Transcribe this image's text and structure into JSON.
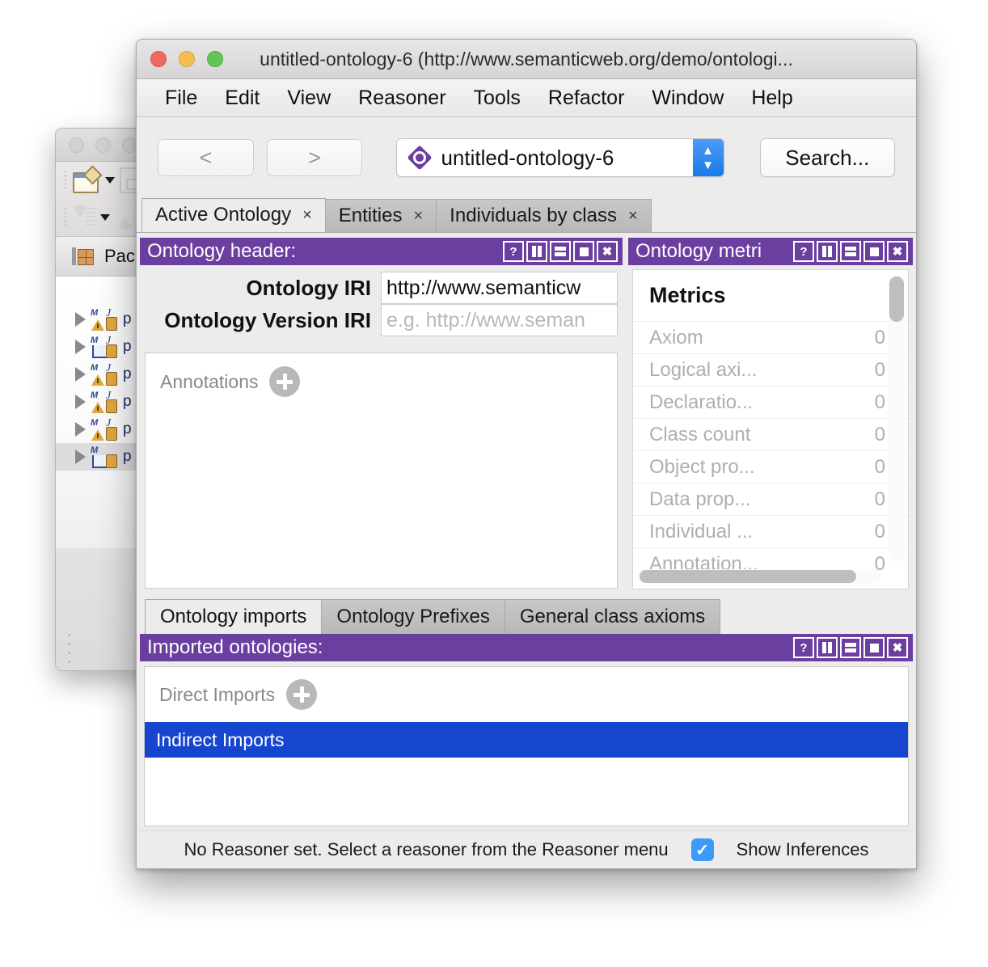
{
  "background_window": {
    "view_tab_label": "Pack",
    "tree_items": [
      {
        "label": "p",
        "type": "jar-warning"
      },
      {
        "label": "p",
        "type": "jar-folder"
      },
      {
        "label": "p",
        "type": "jar-warning"
      },
      {
        "label": "p",
        "type": "jar-warning"
      },
      {
        "label": "p",
        "type": "jar-warning"
      },
      {
        "label": "p",
        "type": "jar-folder",
        "selected": true
      }
    ]
  },
  "window": {
    "title": "untitled-ontology-6 (http://www.semanticweb.org/demo/ontologi...",
    "traffic_lights": [
      "close",
      "minimize",
      "maximize"
    ]
  },
  "menubar": {
    "items": [
      "File",
      "Edit",
      "View",
      "Reasoner",
      "Tools",
      "Refactor",
      "Window",
      "Help"
    ]
  },
  "toolbar": {
    "back_label": "<",
    "forward_label": ">",
    "ontology_combo_value": "untitled-ontology-6",
    "search_label": "Search..."
  },
  "top_tabs": [
    {
      "label": "Active Ontology",
      "close": "×",
      "active": true
    },
    {
      "label": "Entities",
      "close": "×",
      "active": false
    },
    {
      "label": "Individuals by class",
      "close": "×",
      "active": false
    }
  ],
  "ontology_header_panel": {
    "title": "Ontology header:",
    "buttons": [
      "?",
      "split-vertical",
      "split-horizontal",
      "maximize",
      "close"
    ],
    "iri_label": "Ontology IRI",
    "iri_value": "http://www.semanticw",
    "version_label": "Ontology Version IRI",
    "version_placeholder": "e.g. http://www.seman",
    "annotations_label": "Annotations",
    "add_annotation_icon": "plus-icon"
  },
  "ontology_metrics_panel": {
    "title": "Ontology metri",
    "buttons": [
      "?",
      "split-vertical",
      "split-horizontal",
      "maximize",
      "close"
    ],
    "metrics_heading": "Metrics",
    "rows": [
      {
        "name": "Axiom",
        "value": "0"
      },
      {
        "name": "Logical axi...",
        "value": "0"
      },
      {
        "name": "Declaratio...",
        "value": "0"
      },
      {
        "name": "Class count",
        "value": "0"
      },
      {
        "name": "Object pro...",
        "value": "0"
      },
      {
        "name": "Data prop...",
        "value": "0"
      },
      {
        "name": "Individual ...",
        "value": "0"
      },
      {
        "name": "Annotation...",
        "value": "0"
      }
    ]
  },
  "mid_tabs": [
    {
      "label": "Ontology imports",
      "active": true
    },
    {
      "label": "Ontology Prefixes",
      "active": false
    },
    {
      "label": "General class axioms",
      "active": false
    }
  ],
  "imported_ontologies_panel": {
    "title": "Imported ontologies:",
    "buttons": [
      "?",
      "split-vertical",
      "split-horizontal",
      "maximize",
      "close"
    ],
    "direct_imports_label": "Direct Imports",
    "add_import_icon": "plus-icon",
    "indirect_imports_label": "Indirect Imports"
  },
  "statusbar": {
    "message": "No Reasoner set. Select a reasoner from the Reasoner menu",
    "show_inferences_label": "Show Inferences",
    "show_inferences_checked": true,
    "check_glyph": "✓"
  },
  "colors": {
    "panel_header_purple": "#6b3fa0",
    "selection_blue": "#1645d0",
    "checkbox_blue": "#3d9bf7",
    "window_chrome": "#ececec"
  }
}
